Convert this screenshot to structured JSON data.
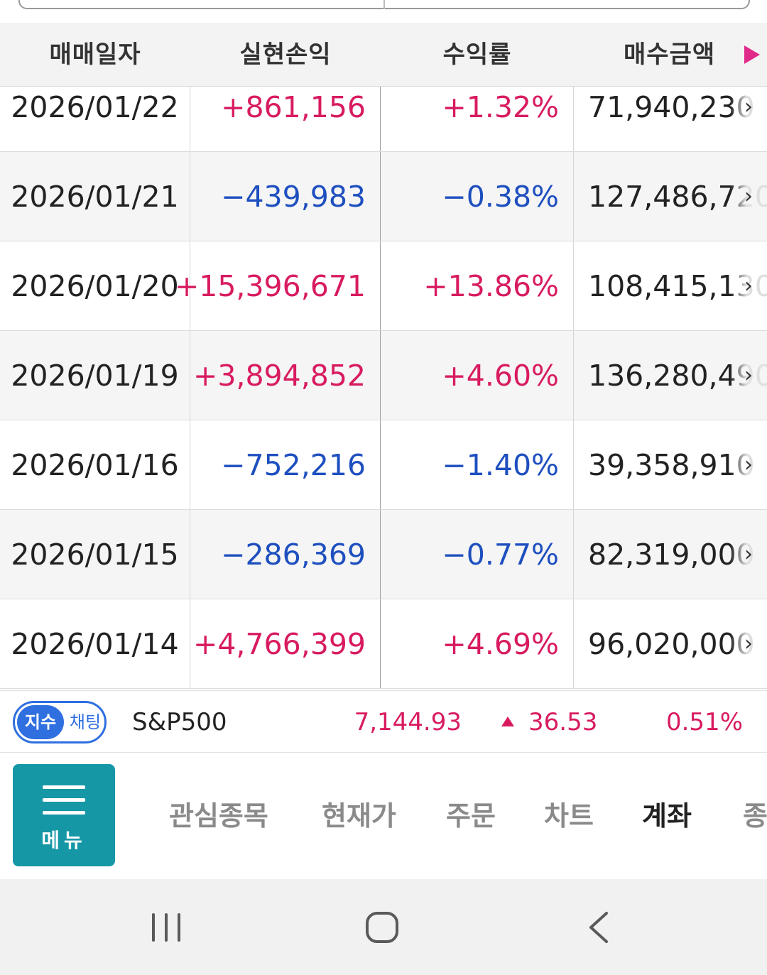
{
  "table": {
    "headers": {
      "date": "매매일자",
      "realized_pl": "실현손익",
      "return_rate": "수익률",
      "buy_amount": "매수금액"
    },
    "rows": [
      {
        "date": "2026/01/22",
        "pl": "+861,156",
        "rate": "+1.32%",
        "amount": "71,940,230",
        "direction": "up"
      },
      {
        "date": "2026/01/21",
        "pl": "−439,983",
        "rate": "−0.38%",
        "amount": "127,486,720",
        "direction": "down"
      },
      {
        "date": "2026/01/20",
        "pl": "+15,396,671",
        "rate": "+13.86%",
        "amount": "108,415,130",
        "direction": "up"
      },
      {
        "date": "2026/01/19",
        "pl": "+3,894,852",
        "rate": "+4.60%",
        "amount": "136,280,490",
        "direction": "up"
      },
      {
        "date": "2026/01/16",
        "pl": "−752,216",
        "rate": "−1.40%",
        "amount": "39,358,910",
        "direction": "down"
      },
      {
        "date": "2026/01/15",
        "pl": "−286,369",
        "rate": "−0.77%",
        "amount": "82,319,000",
        "direction": "down"
      },
      {
        "date": "2026/01/14",
        "pl": "+4,766,399",
        "rate": "+4.69%",
        "amount": "96,020,000",
        "direction": "up"
      }
    ]
  },
  "ticker": {
    "toggle_on": "지수",
    "toggle_off": "채팅",
    "name": "S&P500",
    "price": "7,144.93",
    "change": "36.53",
    "change_pct": "0.51%",
    "change_direction": "up"
  },
  "bottom_nav": {
    "menu_label": "메뉴",
    "items": [
      "관심종목",
      "현재가",
      "주문",
      "차트",
      "계좌",
      "종"
    ],
    "active": "계좌"
  },
  "colors": {
    "positive": "#d81b60",
    "negative": "#1e4fbf",
    "accent_teal": "#1597a6",
    "toggle_blue": "#2f6fe0",
    "header_arrow": "#e02a8a"
  },
  "icons": [
    "menu-hamburger-icon",
    "triangle-right-icon",
    "chevron-right-icon",
    "triangle-up-icon",
    "recent-apps-icon",
    "home-icon",
    "back-icon"
  ]
}
